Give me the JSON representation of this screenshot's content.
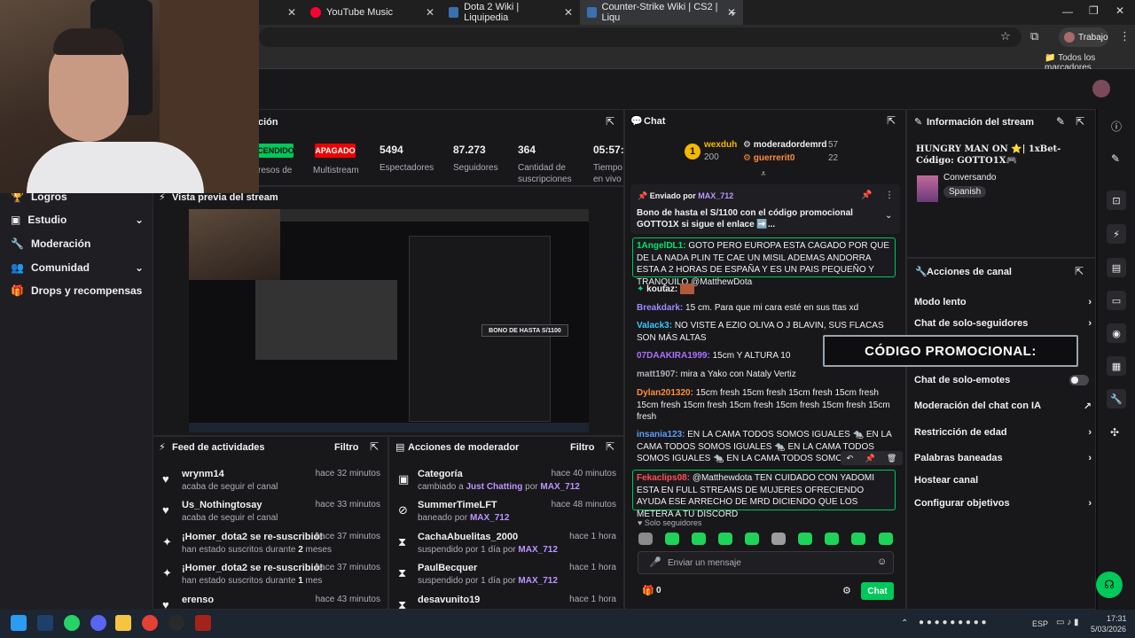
{
  "browser": {
    "tabs": [
      {
        "label": "YouTube Music"
      },
      {
        "label": "Dota 2 Wiki | Liquipedia"
      },
      {
        "label": "Counter-Strike Wiki | CS2 | Liqu"
      }
    ],
    "profile": "Trabajo",
    "bookmarks": "Todos los marcadores"
  },
  "stats": {
    "header_fragment": "ción",
    "status_on": "CENDIDO",
    "status_off": "APAGADO",
    "multistream_label": "Multistream",
    "income_label": "resos de",
    "viewers": {
      "value": "5494",
      "label": "Espectadores"
    },
    "followers": {
      "value": "87.273",
      "label": "Seguidores"
    },
    "subs": {
      "value": "364",
      "label1": "Cantidad de",
      "label2": "suscripciones"
    },
    "time": {
      "value": "05:57:5",
      "label1": "Tiempo",
      "label2": "en vivo"
    }
  },
  "sidebar": {
    "items": [
      {
        "label": "Logros"
      },
      {
        "label": "Estudio"
      },
      {
        "label": "Moderación"
      },
      {
        "label": "Comunidad"
      },
      {
        "label": "Drops y recompensas"
      }
    ]
  },
  "preview": {
    "title": "Vista previa del stream",
    "overlay": "BONO DE HASTA S/1100"
  },
  "feed": {
    "title": "Feed de actividades",
    "filter": "Filtro",
    "items": [
      {
        "name": "wrynm14",
        "sub": "acaba de seguir el canal",
        "time": "hace 32 minutos",
        "icon": "heart-icon"
      },
      {
        "name": "Us_Nothingtosay",
        "sub": "acaba de seguir el canal",
        "time": "hace 33 minutos",
        "icon": "heart-icon"
      },
      {
        "name": "¡Homer_dota2 se re-suscribió!",
        "sub_a": "han estado suscritos durante ",
        "sub_b": "2",
        "sub_c": " meses",
        "time": "hace 37 minutos",
        "icon": "star-icon"
      },
      {
        "name": "¡Homer_dota2 se re-suscribió!",
        "sub_a": "han estado suscritos durante ",
        "sub_b": "1",
        "sub_c": " mes",
        "time": "hace 37 minutos",
        "icon": "star-icon"
      },
      {
        "name": "erenso",
        "time": "hace 43 minutos",
        "icon": "heart-icon"
      }
    ]
  },
  "mod": {
    "title": "Acciones de moderador",
    "filter": "Filtro",
    "items": [
      {
        "name": "Categoría",
        "sub_a": "cambiado a ",
        "sub_b": "Just Chatting",
        "sub_c": " por ",
        "sub_d": "MAX_712",
        "time": "hace 40 minutos",
        "icon": "category-icon"
      },
      {
        "name": "SummerTimeLFT",
        "sub_a": "baneado por ",
        "sub_d": "MAX_712",
        "time": "hace 48 minutos",
        "icon": "ban-icon"
      },
      {
        "name": "CachaAbuelitas_2000",
        "sub_a": "suspendido por 1 día por ",
        "sub_d": "MAX_712",
        "time": "hace 1 hora",
        "icon": "hourglass-icon"
      },
      {
        "name": "PaulBecquer",
        "sub_a": "suspendido por 1 día por ",
        "sub_d": "MAX_712",
        "time": "hace 1 hora",
        "icon": "hourglass-icon"
      },
      {
        "name": "desavunito19",
        "time": "hace 1 hora",
        "icon": "hourglass-icon"
      }
    ]
  },
  "chat": {
    "title": "Chat",
    "leaderboard": {
      "rank": "1",
      "u1": "wexduh",
      "u1_points": "200",
      "u2": "moderadordemrd",
      "u2_points": "57",
      "u3": "guerrerit0",
      "u3_points": "22"
    },
    "pinned": {
      "sent_by": "Enviado por",
      "sender": "MAX_712",
      "text": "Bono de hasta el S/1100 con el código promocional GOTTO1X si sigue el enlace ➡️..."
    },
    "messages": [
      {
        "user": "1AngelDL1:",
        "text": " GOTO PERO EUROPA ESTA CAGADO POR QUE DE LA NADA PLIN TE CAE UN MISIL ADEMAS ANDORRA ESTA A 2 HORAS DE ESPAÑA Y ES UN PAIS PEQUEÑO Y TRANQUILO @MatthewDota",
        "color": "#00e46e"
      },
      {
        "user": "koutaz:",
        "text": "",
        "color": "#efeff1"
      },
      {
        "user": "Breakdark:",
        "text": " 15 cm. Para que mi cara esté en sus ttas xd",
        "color": "#9b8bff"
      },
      {
        "user": "Valack3:",
        "text": " NO VISTE A EZIO OLIVA O J BLAVIN, SUS FLACAS SON MÁS ALTAS",
        "color": "#3fc5ff"
      },
      {
        "user": "07DAAKIRA1999:",
        "text": " 15cm Y ALTURA 10",
        "color": "#a970ff"
      },
      {
        "user": "matt1907:",
        "text": " mira a Yako con Nataly Vertiz",
        "color": "#adadb8"
      },
      {
        "user": "Dylan201320:",
        "text": " 15cm fresh 15cm fresh 15cm fresh 15cm fresh 15cm fresh 15cm fresh 15cm fresh 15cm fresh 15cm fresh 15cm fresh",
        "color": "#ff8c3b"
      },
      {
        "user": "insania123:",
        "text": " EN LA CAMA TODOS SOMOS IGUALES 🐀 EN LA CAMA TODOS SOMOS IGUALES 🐀 EN LA CAMA TODOS SOMOS IGUALES 🐀 EN LA CAMA TODOS SOMOS IGUALES",
        "color": "#5d9cff"
      },
      {
        "user": "Fekaclips08:",
        "text": " @Matthewdota TEN CUIDADO CON YADOMI ESTA EN FULL STREAMS DE MUJERES OFRECIENDO AYUDA ESE ARRECHO DE MRD DICIENDO QUE LOS METERA A TU DISCORD",
        "color": "#ff4f4f"
      }
    ],
    "followers_only": "Solo seguidores",
    "input_placeholder": "Enviar un mensaje",
    "points": "0",
    "send": "Chat"
  },
  "info": {
    "title": "Información del stream",
    "stream_title": "HUNGRY MAN ON ⭐| 1xBet- Código: GOTTO1X🎮",
    "category": "Conversando",
    "tag": "Spanish"
  },
  "actions": {
    "title": "Acciones de canal",
    "items": [
      {
        "label": "Modo lento"
      },
      {
        "label": "Chat de solo-seguidores"
      },
      {
        "label": "Chat de solo-emotes"
      },
      {
        "label": "Moderación del chat con IA"
      },
      {
        "label": "Restricción de edad"
      },
      {
        "label": "Palabras baneadas"
      },
      {
        "label": "Hostear canal"
      },
      {
        "label": "Configurar objetivos"
      }
    ],
    "promo_overlay": "CÓDIGO PROMOCIONAL:"
  },
  "taskbar": {
    "lang": "ESP",
    "time": "17:31",
    "date": "5/03/2026"
  },
  "colors": {
    "accent": "#9147ff",
    "green": "#00c85a",
    "red": "#eb0400"
  }
}
